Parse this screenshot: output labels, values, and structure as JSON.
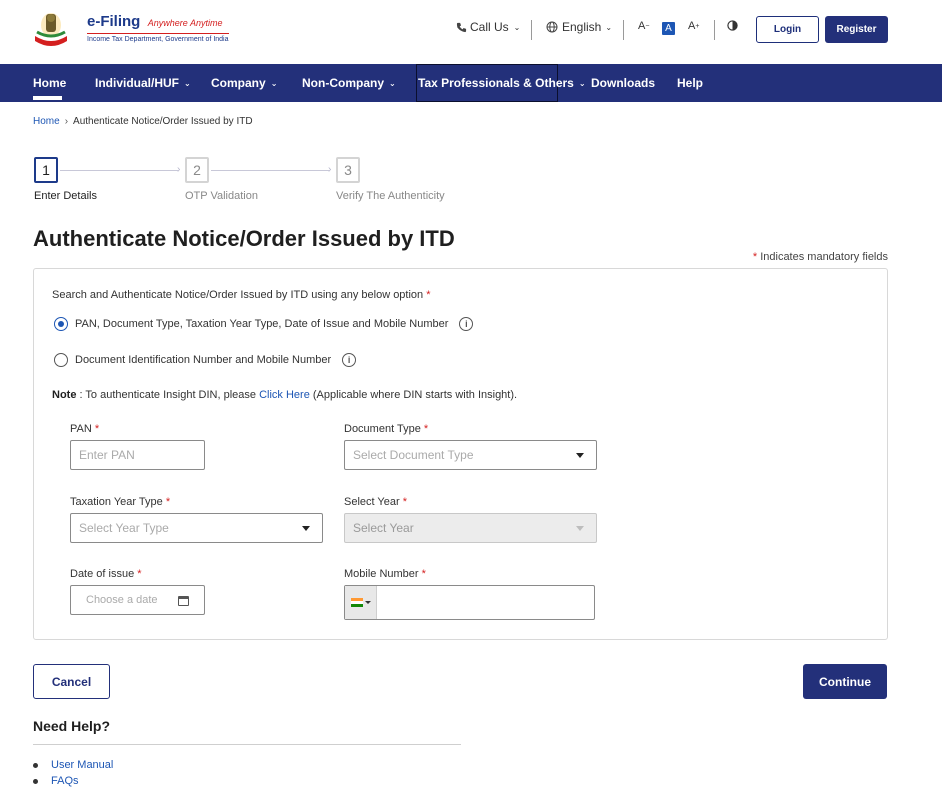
{
  "header": {
    "logo_title": "e-Filing",
    "logo_tagline": "Anywhere Anytime",
    "logo_subtitle": "Income Tax Department, Government of India",
    "call_us": "Call Us",
    "language": "English",
    "font_decrease": "A",
    "font_normal": "A",
    "font_increase": "A",
    "login": "Login",
    "register": "Register"
  },
  "nav": {
    "items": [
      {
        "label": "Home"
      },
      {
        "label": "Individual/HUF"
      },
      {
        "label": "Company"
      },
      {
        "label": "Non-Company"
      },
      {
        "label": "Tax Professionals & Others"
      },
      {
        "label": "Downloads"
      },
      {
        "label": "Help"
      }
    ]
  },
  "breadcrumb": {
    "home": "Home",
    "current": "Authenticate Notice/Order Issued by ITD"
  },
  "stepper": {
    "steps": [
      {
        "number": "1",
        "label": "Enter Details"
      },
      {
        "number": "2",
        "label": "OTP Validation"
      },
      {
        "number": "3",
        "label": "Verify The Authenticity"
      }
    ]
  },
  "page": {
    "title": "Authenticate Notice/Order Issued by ITD",
    "mandatory_note": "Indicates mandatory fields"
  },
  "form": {
    "search_label": "Search and Authenticate Notice/Order Issued by ITD using any below option",
    "option1": "PAN, Document Type, Taxation Year Type, Date of Issue and Mobile Number",
    "option2": "Document Identification Number and Mobile Number",
    "note_prefix": "Note",
    "note_text": ": To authenticate Insight DIN, please",
    "note_link": "Click Here",
    "note_suffix": "(Applicable where DIN starts with Insight).",
    "pan_label": "PAN",
    "pan_placeholder": "Enter PAN",
    "doc_type_label": "Document Type",
    "doc_type_placeholder": "Select Document Type",
    "tax_year_type_label": "Taxation Year Type",
    "tax_year_type_placeholder": "Select Year Type",
    "select_year_label": "Select Year",
    "select_year_placeholder": "Select Year",
    "date_label": "Date of issue",
    "date_placeholder": "Choose a date",
    "mobile_label": "Mobile Number",
    "mobile_value": ""
  },
  "actions": {
    "cancel": "Cancel",
    "continue": "Continue"
  },
  "help": {
    "title": "Need Help?",
    "links": [
      {
        "label": "User Manual"
      },
      {
        "label": "FAQs"
      }
    ]
  },
  "colors": {
    "primary": "#23307a",
    "link": "#1d56b4",
    "required": "#d41f1f"
  }
}
